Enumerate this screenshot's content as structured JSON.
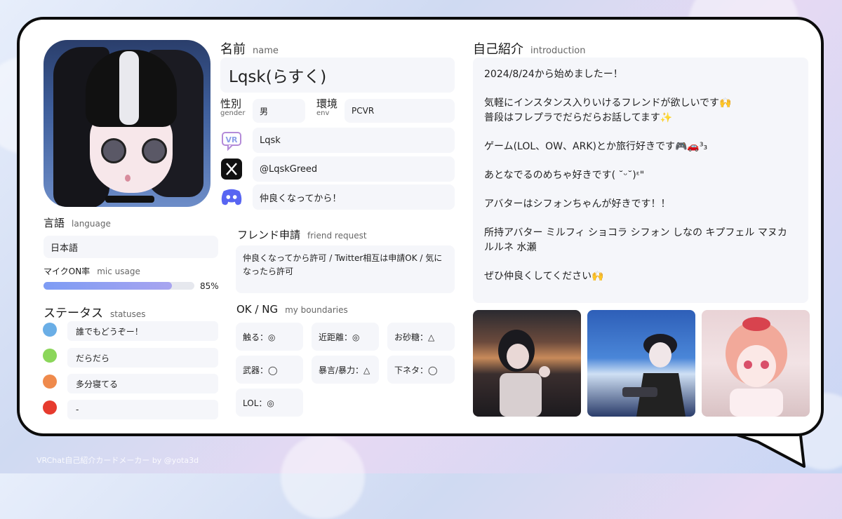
{
  "profile": {
    "name_label": "名前",
    "name_sub": "name",
    "name": "Lqsk(らすく)",
    "gender_label": "性別",
    "gender_sub": "gender",
    "gender": "男",
    "env_label": "環境",
    "env_sub": "env",
    "env": "PCVR",
    "vrchat_name": "Lqsk",
    "x_handle": "@LqskGreed",
    "discord": "仲良くなってから！"
  },
  "language": {
    "label": "言語",
    "sub": "language",
    "value": "日本語"
  },
  "mic": {
    "label": "マイクON率",
    "sub": "mic usage",
    "percent_text": "85%",
    "fraction": 0.85
  },
  "statuses": {
    "label": "ステータス",
    "sub": "statuses",
    "items": [
      {
        "color": "#6aaee6",
        "text": "誰でもどうぞー！"
      },
      {
        "color": "#8bd65a",
        "text": "だらだら"
      },
      {
        "color": "#ef8a4c",
        "text": "多分寝てる"
      },
      {
        "color": "#e63b2e",
        "text": "-"
      }
    ]
  },
  "friend_request": {
    "label": "フレンド申請",
    "sub": "friend request",
    "text": "仲良くなってから許可 / Twitter相互は申請OK / 気になったら許可"
  },
  "boundaries": {
    "label": "OK / NG",
    "sub": "my boundaries",
    "items": [
      "触る：◎",
      "近距離：◎",
      "お砂糖：△",
      "武器：◯",
      "暴言/暴力：△",
      "下ネタ：◯",
      "LOL：◎"
    ]
  },
  "intro": {
    "label": "自己紹介",
    "sub": "introduction",
    "paragraphs": [
      "2024/8/24から始めましたー！",
      "気軽にインスタンス入りいけるフレンドが欲しいです🙌\n普段はフレプラでだらだらお話してます✨",
      "ゲーム(LOL、OW、ARK)とか旅行好きです🎮🚗³₃",
      "あとなでるのめちゃ好きです( ˘ᵕ˘)ᵋ\"",
      "アバターはシフォンちゃんが好きです！！",
      "所持アバター ミルフィ ショコラ シフォン しなの キプフェル マヌカ ルルネ 水瀬",
      "ぜひ仲良くしてください🙌"
    ]
  },
  "footer": "VRChat自己紹介カードメーカー by @yota3d",
  "icons": {
    "vrchat": "vrchat-icon",
    "x": "x-logo-icon",
    "discord": "discord-icon"
  }
}
